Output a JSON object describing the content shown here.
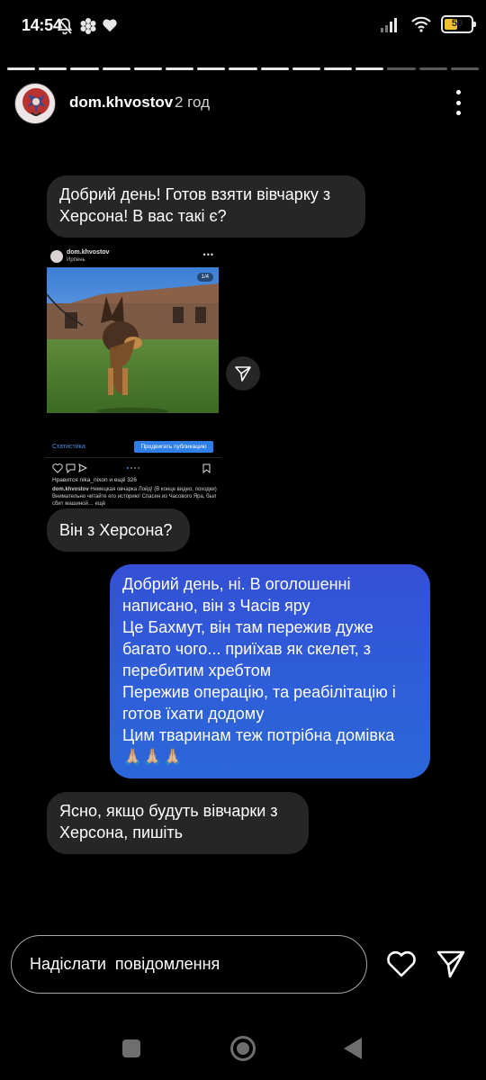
{
  "status_bar": {
    "time": "14:54",
    "battery": "50",
    "battery_level": 0.5,
    "icons": [
      "bell-off-icon",
      "flower-icon",
      "heart-icon",
      "signal-icon",
      "wifi-icon",
      "battery-icon"
    ]
  },
  "story": {
    "segments_total": 15,
    "current_segment": 12
  },
  "header": {
    "username": "dom.khvostov",
    "time_ago": "2 год"
  },
  "messages": [
    {
      "from": "other",
      "text": "Добрий день! Готов взяти вівчарку з Херсона! В вас такі є?"
    },
    {
      "from": "other",
      "text": "Він з Херсона?"
    },
    {
      "from": "me",
      "lines": [
        "Добрий день, ні. В оголошенні написано, він з Часів яру",
        "Це Бахмут, він там пережив дуже багато чого... приїхав як скелет, з перебитим хребтом",
        "Пережив операцію, та реабілітацію і готов їхати додому",
        "Цим тваринам теж потрібна домівка 🙏🏼🙏🏼🙏🏼"
      ]
    },
    {
      "from": "other",
      "text": "Ясно, якщо будуть вівчарки з Херсона, пишіть"
    }
  ],
  "shared_post": {
    "username": "dom.khvostov",
    "location": "Ирпень",
    "counter": "1/4",
    "stats_link": "Статистика",
    "promote_label": "Продвигать публикацию",
    "likes_text": "Нравится nika_nixon и ещё 326",
    "caption_user": "dom.khvostov",
    "caption_text": "Немецкая овчарка Лойд! (В конце видео, походки) Внимательно читайте его историю! Спасен из Часового Яра, был сбит машиной… ещё"
  },
  "composer": {
    "placeholder": "Надіслати  повідомлення"
  },
  "colors": {
    "background": "#000000",
    "incoming_bubble": "#262626",
    "outgoing_bubble_top": "#3450d6",
    "outgoing_bubble_bottom": "#2b67d8",
    "battery": "#f2c035"
  }
}
